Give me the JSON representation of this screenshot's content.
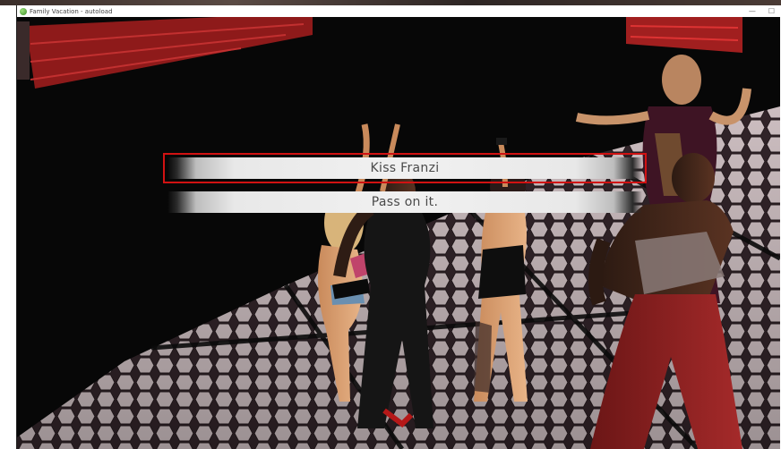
{
  "window": {
    "title": "Family Vacation - autoload",
    "minimize_glyph": "—",
    "maximize_glyph": "☐"
  },
  "menu": {
    "choices": [
      {
        "label": "Kiss Franzi",
        "selected": true
      },
      {
        "label": "Pass on it.",
        "selected": false
      }
    ]
  },
  "colors": {
    "selection_outline": "#d11212",
    "floor_tile": "#e9d8dc",
    "wall": "#0a0a0a",
    "accent_red": "#b11d1d"
  },
  "icons": {
    "app": "app-icon"
  }
}
